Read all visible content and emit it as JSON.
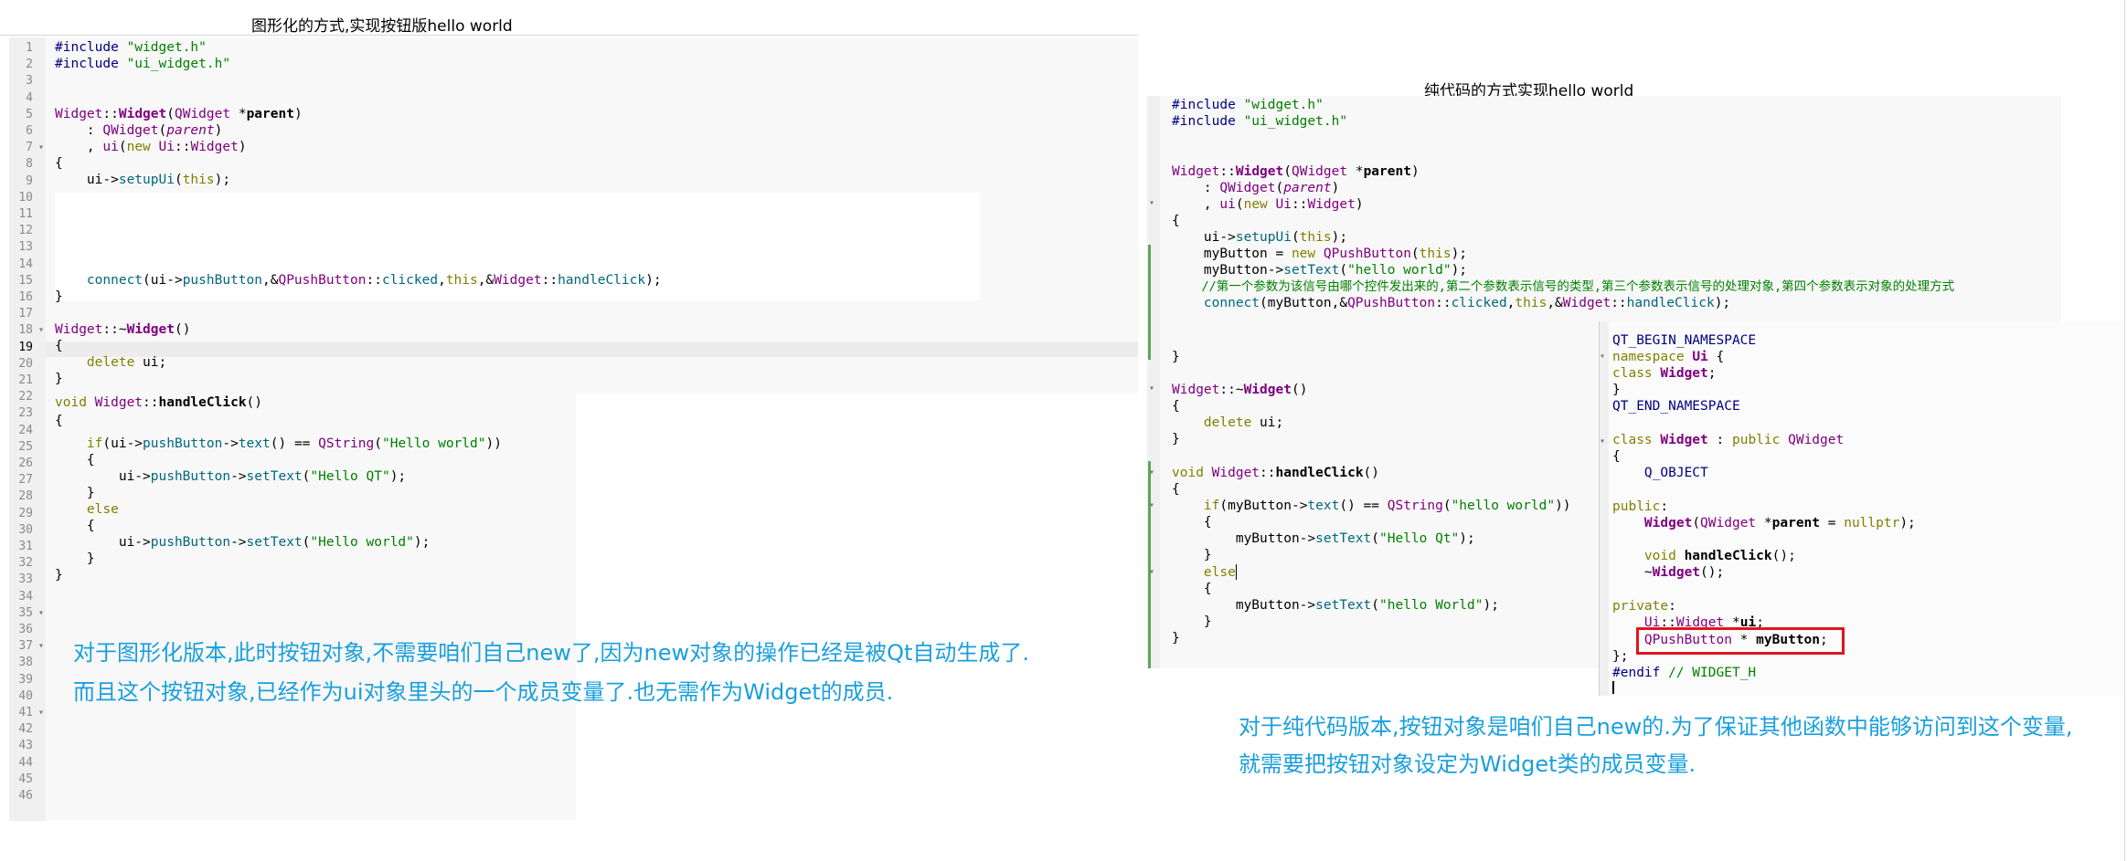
{
  "left_caption": "图形化的方式,实现按钮版hello world",
  "right_caption": "纯代码的方式实现hello world",
  "left_code": {
    "line_numbers": [
      "1",
      "2",
      "3",
      "4",
      "5",
      "6",
      "7",
      "8",
      "9",
      "10",
      "11",
      "12",
      "13",
      "14",
      "15",
      "16",
      "17",
      "18",
      "19",
      "20",
      "21",
      "22",
      "23",
      "24",
      "25",
      "26",
      "27",
      "28",
      "29",
      "30",
      "31",
      "32",
      "33",
      "34",
      "35",
      "36",
      "37",
      "38",
      "39",
      "40",
      "41",
      "42",
      "43",
      "44",
      "45",
      "46"
    ],
    "l1_kw": "#include",
    "l1_str": "\"widget.h\"",
    "l2_kw": "#include",
    "l2_str": "\"ui_widget.h\"",
    "l5_a": "Widget",
    "l5_b": "::",
    "l5_c": "Widget",
    "l5_d": "(",
    "l5_e": "QWidget",
    "l5_f": " *",
    "l5_g": "parent",
    "l5_h": ")",
    "l6_a": "    : ",
    "l6_b": "QWidget",
    "l6_c": "(",
    "l6_d": "parent",
    "l6_e": ")",
    "l7_a": "    , ",
    "l7_b": "ui",
    "l7_c": "(",
    "l7_d": "new",
    "l7_e": " ",
    "l7_f": "Ui",
    "l7_g": "::",
    "l7_h": "Widget",
    "l7_i": ")",
    "l8": "{",
    "l9_a": "    ui->",
    "l9_b": "setupUi",
    "l9_c": "(",
    "l9_d": "this",
    "l9_e": ");",
    "l15_a": "    ",
    "l15_b": "connect",
    "l15_c": "(ui->",
    "l15_d": "pushButton",
    "l15_e": ",&",
    "l15_f": "QPushButton",
    "l15_g": "::",
    "l15_h": "clicked",
    "l15_i": ",",
    "l15_j": "this",
    "l15_k": ",&",
    "l15_l": "Widget",
    "l15_m": "::",
    "l15_n": "handleClick",
    "l15_o": ");",
    "l16": "}",
    "l18_a": "Widget",
    "l18_b": "::~",
    "l18_c": "Widget",
    "l18_d": "()",
    "l19": "{",
    "l20_a": "    ",
    "l20_b": "delete",
    "l20_c": " ui;",
    "l21": "}",
    "l22_a": "void",
    "l22_b": " ",
    "l22_c": "Widget",
    "l22_d": "::",
    "l22_e": "handleClick",
    "l22_f": "()",
    "l23": "{",
    "l24_a": "    ",
    "l24_b": "if",
    "l24_c": "(ui->",
    "l24_d": "pushButton",
    "l24_e": "->",
    "l24_f": "text",
    "l24_g": "() == ",
    "l24_h": "QString",
    "l24_i": "(",
    "l24_j": "\"Hello world\"",
    "l24_k": "))",
    "l25": "    {",
    "l26_a": "        ui->",
    "l26_b": "pushButton",
    "l26_c": "->",
    "l26_d": "setText",
    "l26_e": "(",
    "l26_f": "\"Hello QT\"",
    "l26_g": ");",
    "l27": "    }",
    "l28": "    else",
    "l29": "    {",
    "l30_a": "        ui->",
    "l30_b": "pushButton",
    "l30_c": "->",
    "l30_d": "setText",
    "l30_e": "(",
    "l30_f": "\"Hello world\"",
    "l30_g": ");",
    "l31": "    }",
    "l32": "}"
  },
  "left_note": {
    "line1": "对于图形化版本,此时按钮对象,不需要咱们自己new了,因为new对象的操作已经是被Qt自动生成了.",
    "line2": "而且这个按钮对象,已经作为ui对象里头的一个成员变量了.也无需作为Widget的成员."
  },
  "right_code": {
    "r1_kw": "#include",
    "r1_str": "\"widget.h\"",
    "r2_kw": "#include",
    "r2_str": "\"ui_widget.h\"",
    "r5_a": "Widget",
    "r5_b": "::",
    "r5_c": "Widget",
    "r5_d": "(",
    "r5_e": "QWidget",
    "r5_f": " *",
    "r5_g": "parent",
    "r5_h": ")",
    "r6_a": "    : ",
    "r6_b": "QWidget",
    "r6_c": "(",
    "r6_d": "parent",
    "r6_e": ")",
    "r7_a": "    , ",
    "r7_b": "ui",
    "r7_c": "(",
    "r7_d": "new",
    "r7_e": " ",
    "r7_f": "Ui",
    "r7_g": "::",
    "r7_h": "Widget",
    "r7_i": ")",
    "r8": "{",
    "r9_a": "    ui->",
    "r9_b": "setupUi",
    "r9_c": "(",
    "r9_d": "this",
    "r9_e": ");",
    "r10_a": "    myButton = ",
    "r10_b": "new",
    "r10_c": " ",
    "r10_d": "QPushButton",
    "r10_e": "(",
    "r10_f": "this",
    "r10_g": ");",
    "r11_a": "    myButton->",
    "r11_b": "setText",
    "r11_c": "(",
    "r11_d": "\"hello world\"",
    "r11_e": ");",
    "r12_a": "    ",
    "r12_b": "//第一个参数为该信号由哪个控件发出来的,第二个参数表示信号的类型,第三个参数表示信号的处理对象,第四个参数表示对象的处理方式",
    "r13_a": "    ",
    "r13_b": "connect",
    "r13_c": "(myButton,&",
    "r13_d": "QPushButton",
    "r13_e": "::",
    "r13_f": "clicked",
    "r13_g": ",",
    "r13_h": "this",
    "r13_i": ",&",
    "r13_j": "Widget",
    "r13_k": "::",
    "r13_l": "handleClick",
    "r13_m": ");",
    "r17": "}",
    "r19_a": "Widget",
    "r19_b": "::~",
    "r19_c": "Widget",
    "r19_d": "()",
    "r20": "{",
    "r21_a": "    ",
    "r21_b": "delete",
    "r21_c": " ui;",
    "r22": "}",
    "r24_a": "void",
    "r24_b": " ",
    "r24_c": "Widget",
    "r24_d": "::",
    "r24_e": "handleClick",
    "r24_f": "()",
    "r25": "{",
    "r26_a": "    ",
    "r26_b": "if",
    "r26_c": "(myButton->",
    "r26_d": "text",
    "r26_e": "() == ",
    "r26_f": "QString",
    "r26_g": "(",
    "r26_h": "\"hello world\"",
    "r26_i": "))",
    "r27": "    {",
    "r28_a": "        myButton->",
    "r28_b": "setText",
    "r28_c": "(",
    "r28_d": "\"Hello Qt\"",
    "r28_e": ");",
    "r29": "    }",
    "r30": "    else",
    "r31": "    {",
    "r32_a": "        myButton->",
    "r32_b": "setText",
    "r32_c": "(",
    "r32_d": "\"hello World\"",
    "r32_e": ");",
    "r33": "    }",
    "r34": "}"
  },
  "header_code": {
    "h1": "QT_BEGIN_NAMESPACE",
    "h2_a": "namespace",
    "h2_b": " ",
    "h2_c": "Ui",
    "h2_d": " {",
    "h3_a": "class",
    "h3_b": " ",
    "h3_c": "Widget",
    "h3_d": ";",
    "h4": "}",
    "h5": "QT_END_NAMESPACE",
    "h7_a": "class",
    "h7_b": " ",
    "h7_c": "Widget",
    "h7_d": " : ",
    "h7_e": "public",
    "h7_f": " ",
    "h7_g": "QWidget",
    "h8": "{",
    "h9": "    Q_OBJECT",
    "h11_a": "public",
    "h11_b": ":",
    "h12_a": "    ",
    "h12_b": "Widget",
    "h12_c": "(",
    "h12_d": "QWidget",
    "h12_e": " *",
    "h12_f": "parent",
    "h12_g": " = ",
    "h12_h": "nullptr",
    "h12_i": ");",
    "h14_a": "    ",
    "h14_b": "void",
    "h14_c": " ",
    "h14_d": "handleClick",
    "h14_e": "();",
    "h15_a": "    ~",
    "h15_b": "Widget",
    "h15_c": "();",
    "h17_a": "private",
    "h17_b": ":",
    "h18_a": "    ",
    "h18_b": "Ui",
    "h18_c": "::",
    "h18_d": "Widget",
    "h18_e": " *",
    "h18_f": "ui",
    "h18_g": ";",
    "h19_a": "    ",
    "h19_b": "QPushButton",
    "h19_c": " * ",
    "h19_d": "myButton",
    "h19_e": ";",
    "h20": "};",
    "h21_a": "#endif",
    "h21_b": " // WIDGET_H"
  },
  "right_note": {
    "line1": "对于纯代码版本,按钮对象是咱们自己new的.为了保证其他函数中能够访问到这个变量,",
    "line2": "就需要把按钮对象设定为Widget类的成员变量."
  },
  "colors": {
    "keyword": "#808000",
    "string": "#008000",
    "class": "#800080",
    "function": "#00677c",
    "preprocessor": "#000080",
    "note": "#1a9fdc",
    "highlight_box": "#e0141e"
  }
}
